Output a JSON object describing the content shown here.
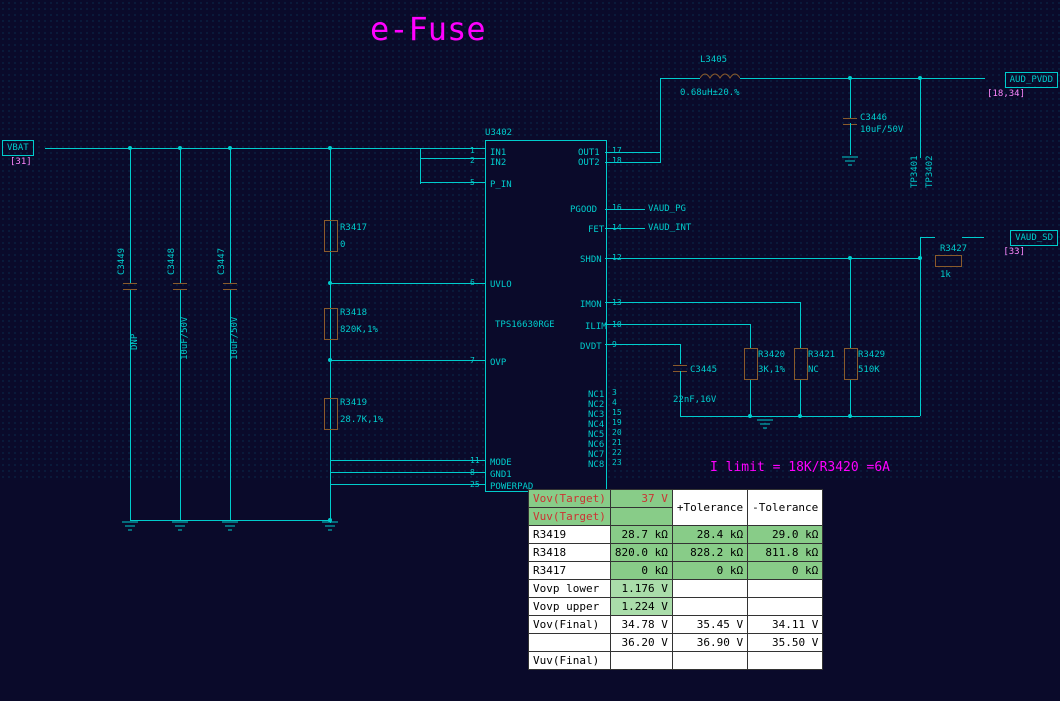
{
  "title": "e-Fuse",
  "ports": {
    "vbat": {
      "name": "VBAT",
      "pages": "[31]"
    },
    "aud_pvdd": {
      "name": "AUD_PVDD",
      "pages": "[18,34]"
    },
    "vaud_sd": {
      "name": "VAUD_SD",
      "pages": "[33]"
    }
  },
  "ic": {
    "ref": "U3402",
    "part": "TPS16630RGE",
    "pins_left": [
      {
        "n": "1",
        "name": "IN1"
      },
      {
        "n": "2",
        "name": "IN2"
      },
      {
        "n": "5",
        "name": "P_IN"
      },
      {
        "n": "6",
        "name": "UVLO"
      },
      {
        "n": "7",
        "name": "OVP"
      },
      {
        "n": "11",
        "name": "MODE"
      },
      {
        "n": "8",
        "name": "GND1"
      },
      {
        "n": "25",
        "name": "POWERPAD"
      }
    ],
    "pins_right": [
      {
        "n": "17",
        "name": "OUT1"
      },
      {
        "n": "18",
        "name": "OUT2"
      },
      {
        "n": "16",
        "name": "PGOOD"
      },
      {
        "n": "14",
        "name": "FET"
      },
      {
        "n": "12",
        "name": "SHDN"
      },
      {
        "n": "13",
        "name": "IMON"
      },
      {
        "n": "10",
        "name": "ILIM"
      },
      {
        "n": "9",
        "name": "DVDT"
      },
      {
        "n": "3",
        "name": "NC1"
      },
      {
        "n": "4",
        "name": "NC2"
      },
      {
        "n": "15",
        "name": "NC3"
      },
      {
        "n": "19",
        "name": "NC4"
      },
      {
        "n": "20",
        "name": "NC5"
      },
      {
        "n": "21",
        "name": "NC6"
      },
      {
        "n": "22",
        "name": "NC7"
      },
      {
        "n": "23",
        "name": "NC8"
      }
    ]
  },
  "parts": {
    "C3449": {
      "ref": "C3449",
      "val": "DNP"
    },
    "C3448": {
      "ref": "C3448",
      "val": "10uF/50V"
    },
    "C3447": {
      "ref": "C3447",
      "val": "10uF/50V"
    },
    "R3417": {
      "ref": "R3417",
      "val": "0"
    },
    "R3418": {
      "ref": "R3418",
      "val": "820K,1%"
    },
    "R3419": {
      "ref": "R3419",
      "val": "28.7K,1%"
    },
    "L3405": {
      "ref": "L3405",
      "val": "0.68uH±20.%"
    },
    "C3446": {
      "ref": "C3446",
      "val": "10uF/50V"
    },
    "TP3401": "TP3401",
    "TP3402": "TP3402",
    "R3427": {
      "ref": "R3427",
      "val": "1k"
    },
    "C3445": {
      "ref": "C3445",
      "val": "22nF,16V"
    },
    "R3420": {
      "ref": "R3420",
      "val": "3K,1%"
    },
    "R3421": {
      "ref": "R3421",
      "val": "NC"
    },
    "R3429": {
      "ref": "R3429",
      "val": "510K"
    }
  },
  "nets": {
    "vaud_pg": "VAUD_PG",
    "vaud_int": "VAUD_INT"
  },
  "note": "I limit = 18K/R3420 =6A",
  "table": {
    "headers": [
      "",
      "",
      "+Tolerance",
      "-Tolerance"
    ],
    "rows": [
      {
        "label": "Vov(Target)",
        "v": "37 V",
        "t1": "",
        "t2": "",
        "cls": "hdr gr"
      },
      {
        "label": "Vuv(Target)",
        "v": "",
        "t1": "",
        "t2": "",
        "cls": "hdr gr"
      },
      {
        "label": "R3419",
        "v": "28.7 kΩ",
        "t1": "28.4 kΩ",
        "t2": "29.0 kΩ",
        "cls": "gr"
      },
      {
        "label": "R3418",
        "v": "820.0 kΩ",
        "t1": "828.2 kΩ",
        "t2": "811.8 kΩ",
        "cls": "gr"
      },
      {
        "label": "R3417",
        "v": "0 kΩ",
        "t1": "0 kΩ",
        "t2": "0 kΩ",
        "cls": "gr"
      },
      {
        "label": "Vovp lower",
        "v": "1.176 V",
        "t1": "",
        "t2": "",
        "cls": "lgr"
      },
      {
        "label": "Vovp upper",
        "v": "1.224 V",
        "t1": "",
        "t2": "",
        "cls": "lgr"
      },
      {
        "label": "Vov(Final)",
        "v": "34.78 V",
        "t1": "35.45 V",
        "t2": "34.11 V",
        "cls": ""
      },
      {
        "label": "",
        "v": "36.20 V",
        "t1": "36.90 V",
        "t2": "35.50 V",
        "cls": ""
      },
      {
        "label": "Vuv(Final)",
        "v": "",
        "t1": "",
        "t2": "",
        "cls": ""
      }
    ]
  }
}
